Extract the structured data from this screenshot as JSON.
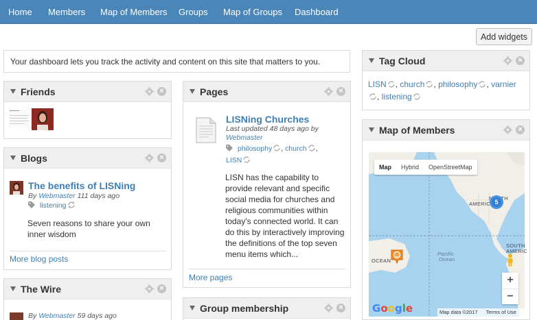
{
  "nav": {
    "items": [
      "Home",
      "Members",
      "Map of Members",
      "Groups",
      "Map of Groups",
      "Dashboard"
    ]
  },
  "toolbar": {
    "add_widgets_label": "Add widgets"
  },
  "intro_text": "Your dashboard lets you track the activity and content on this site that matters to you.",
  "friends": {
    "title": "Friends"
  },
  "blogs": {
    "title": "Blogs",
    "post_title": "The benefits of LISNing",
    "by_prefix": "By",
    "author": "Webmaster",
    "time_ago": "111 days ago",
    "tag": "listening",
    "excerpt": "Seven reasons to share your own inner wisdom",
    "more_label": "More blog posts"
  },
  "wire": {
    "title": "The Wire",
    "by_prefix": "By",
    "author": "Webmaster",
    "time_ago": "59 days ago"
  },
  "pages": {
    "title": "Pages",
    "page_title": "LISNing Churches",
    "updated_prefix": "Last updated 48 days ago by",
    "author": "Webmaster",
    "tags": [
      "philosophy",
      "church",
      "LISN"
    ],
    "excerpt": "LISN has the capability to provide relevant and specific social media for churches and religious communities within today's connected world. It can do this by interactively improving the definitions of the top seven menu items which...",
    "more_label": "More pages"
  },
  "group_membership": {
    "title": "Group membership"
  },
  "tag_cloud": {
    "title": "Tag Cloud",
    "tags": [
      "LISN",
      "church",
      "philosophy",
      "varnier",
      "listening"
    ]
  },
  "map_members": {
    "title": "Map of Members",
    "map_types": [
      "Map",
      "Hybrid",
      "OpenStreetMap"
    ],
    "active_type": "Map",
    "cluster_count": "5",
    "labels": {
      "north_america_1": "NORTH",
      "north_america_2": "AMERICA",
      "south_1": "SOUTH",
      "south_2": "AMERIC",
      "ocean": "OCEAN",
      "pacific_1": "Pacific",
      "pacific_2": "Ocean"
    },
    "zoom_in": "+",
    "zoom_out": "−",
    "attribution": "Map data ©2017",
    "terms": "Terms of Use",
    "google": "Google"
  },
  "colors": {
    "nav_bg": "#4a86b8",
    "link": "#3f7fb3",
    "header_bg": "#efefef",
    "water": "#a8d3ee",
    "land": "#f1efe8"
  }
}
